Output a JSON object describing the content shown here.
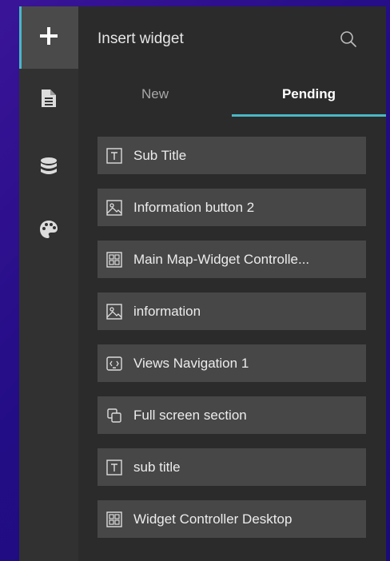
{
  "panel": {
    "title": "Insert widget"
  },
  "tabs": [
    {
      "label": "New"
    },
    {
      "label": "Pending"
    }
  ],
  "rail": {
    "items": [
      {
        "icon": "plus-icon"
      },
      {
        "icon": "document-icon"
      },
      {
        "icon": "database-icon"
      },
      {
        "icon": "palette-icon"
      }
    ]
  },
  "widgets": [
    {
      "label": "Sub Title",
      "icon": "text-icon"
    },
    {
      "label": "Information button 2",
      "icon": "image-icon"
    },
    {
      "label": "Main Map-Widget Controlle...",
      "icon": "widget-controller-icon"
    },
    {
      "label": "information",
      "icon": "image-icon"
    },
    {
      "label": "Views Navigation 1",
      "icon": "views-navigation-icon"
    },
    {
      "label": "Full screen section",
      "icon": "section-icon"
    },
    {
      "label": "sub title",
      "icon": "text-icon"
    },
    {
      "label": "Widget Controller Desktop",
      "icon": "widget-controller-icon"
    }
  ],
  "colors": {
    "accent": "#4ab7c6",
    "background": "#2b2b2b",
    "item_background": "#474747",
    "rail_background": "#313131"
  }
}
